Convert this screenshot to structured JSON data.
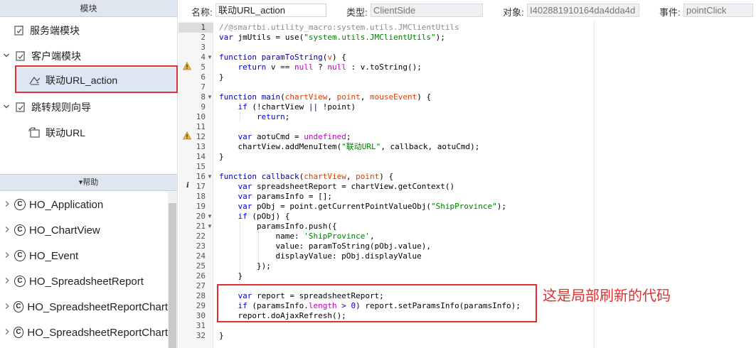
{
  "modules_panel": {
    "title": "模块",
    "items": [
      {
        "label": "服务端模块",
        "icon": "server-module-icon"
      },
      {
        "label": "客户端模块",
        "icon": "client-module-icon"
      },
      {
        "label": "联动URL_action",
        "icon": "action-link-icon"
      },
      {
        "label": "跳转规则向导",
        "icon": "jump-wizard-icon"
      },
      {
        "label": "联动URL",
        "icon": "refresh-link-icon"
      }
    ]
  },
  "help_panel": {
    "title": "▾帮助",
    "class_badge": "C",
    "items": [
      {
        "label": "HO_Application"
      },
      {
        "label": "HO_ChartView"
      },
      {
        "label": "HO_Event"
      },
      {
        "label": "HO_SpreadsheetReport"
      },
      {
        "label": "HO_SpreadsheetReportChart"
      },
      {
        "label": "HO_SpreadsheetReportChart"
      }
    ]
  },
  "props": {
    "name_label": "名称:",
    "name_value": "联动URL_action",
    "type_label": "类型:",
    "type_value": "ClientSide",
    "object_label": "对象:",
    "object_value": "I402881910164da4dda4d",
    "event_label": "事件:",
    "event_value": "pointClick"
  },
  "editor": {
    "line_numbers": [
      "1",
      "2",
      "3",
      "4",
      "5",
      "6",
      "7",
      "8",
      "9",
      "10",
      "11",
      "12",
      "13",
      "14",
      "15",
      "16",
      "17",
      "18",
      "19",
      "20",
      "21",
      "22",
      "23",
      "24",
      "25",
      "26",
      "27",
      "28",
      "29",
      "30",
      "31",
      "32"
    ],
    "fold_marker": "▼",
    "info_marker": "i",
    "annotation": "这是局部刷新的代码"
  }
}
